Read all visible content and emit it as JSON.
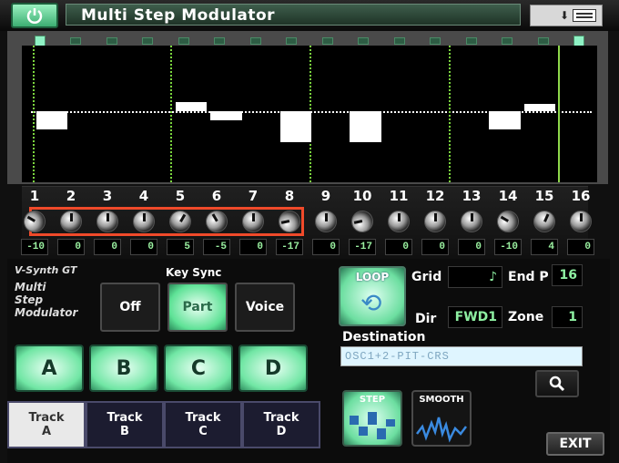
{
  "window": {
    "title": "Multi Step Modulator"
  },
  "graph": {
    "steps": [
      -10,
      0,
      0,
      0,
      5,
      -5,
      0,
      -17,
      0,
      -17,
      0,
      0,
      0,
      -10,
      4,
      0
    ],
    "active_step_markers": [
      1,
      16
    ]
  },
  "knobs": {
    "numbers": [
      "1",
      "2",
      "3",
      "4",
      "5",
      "6",
      "7",
      "8",
      "9",
      "10",
      "11",
      "12",
      "13",
      "14",
      "15",
      "16"
    ],
    "values": [
      "-10",
      "0",
      "0",
      "0",
      "5",
      "-5",
      "0",
      "-17",
      "0",
      "-17",
      "0",
      "0",
      "0",
      "-10",
      "4",
      "0"
    ],
    "selection_range": "1-8"
  },
  "brand": {
    "product": "V-Synth GT",
    "module_line1": "Multi",
    "module_line2": "Step",
    "module_line3": "Modulator"
  },
  "key_sync": {
    "label": "Key Sync",
    "options": [
      "Off",
      "Part",
      "Voice"
    ],
    "selected": "Part"
  },
  "groups": [
    "A",
    "B",
    "C",
    "D"
  ],
  "tracks": [
    {
      "line1": "Track",
      "line2": "A"
    },
    {
      "line1": "Track",
      "line2": "B"
    },
    {
      "line1": "Track",
      "line2": "C"
    },
    {
      "line1": "Track",
      "line2": "D"
    }
  ],
  "loop": {
    "label": "LOOP"
  },
  "grid": {
    "label": "Grid",
    "value": "♪"
  },
  "end_point": {
    "label": "End P",
    "value": "16"
  },
  "dir": {
    "label": "Dir",
    "value": "FWD1"
  },
  "zone": {
    "label": "Zone",
    "value": "1"
  },
  "destination": {
    "label": "Destination",
    "value": "OSC1+2-PIT-CRS"
  },
  "modes": {
    "step_label": "STEP",
    "smooth_label": "SMOOTH",
    "selected": "STEP"
  },
  "exit_label": "EXIT",
  "colors": {
    "accent_green": "#6cdea0",
    "value_text": "#9af0a0",
    "selection": "#f04a2a"
  }
}
